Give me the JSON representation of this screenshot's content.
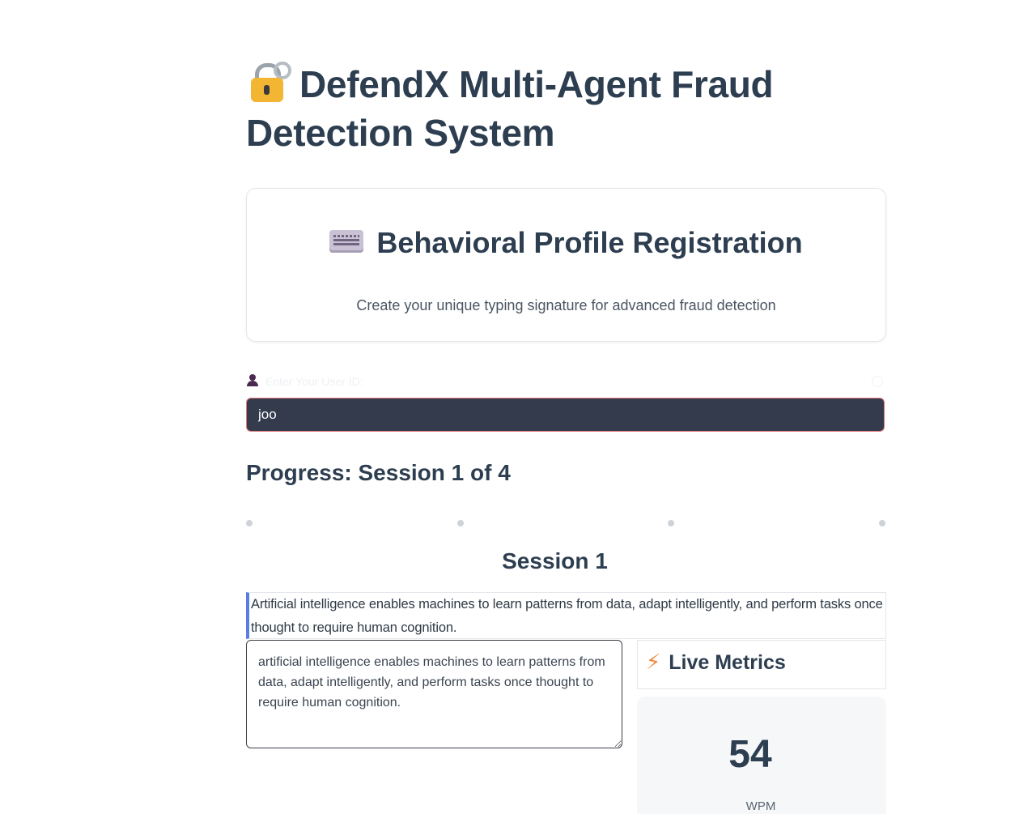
{
  "header": {
    "title": "DefendX Multi-Agent Fraud Detection System",
    "title_icon": "lock-with-key-icon"
  },
  "registration_card": {
    "title": "Behavioral Profile Registration",
    "title_icon": "keyboard-icon",
    "subtitle": "Create your unique typing signature for advanced fraud detection"
  },
  "user_id": {
    "label": "Enter Your User ID:",
    "label_icon": "user-icon",
    "value": "joo"
  },
  "progress": {
    "title": "Progress: Session 1 of 4",
    "current_session": 1,
    "total_sessions": 4
  },
  "session": {
    "title": "Session 1",
    "prompt_text": "Artificial intelligence enables machines to learn patterns from data, adapt intelligently, and perform tasks once thought to require human cognition.",
    "typed_text": "artificial intelligence enables machines to learn patterns from data, adapt intelligently, and perform tasks once thought to require human cognition."
  },
  "live_metrics": {
    "title": "Live Metrics",
    "icon": "lightning-bolt-icon",
    "wpm_value": "54",
    "wpm_label": "WPM"
  },
  "colors": {
    "title_text": "#2d3e50",
    "input_background": "#343b4d",
    "input_border": "#e07a7a",
    "prompt_accent": "#5b7de0",
    "bolt": "#f0883e",
    "metric_card_background": "#f6f7f9"
  }
}
